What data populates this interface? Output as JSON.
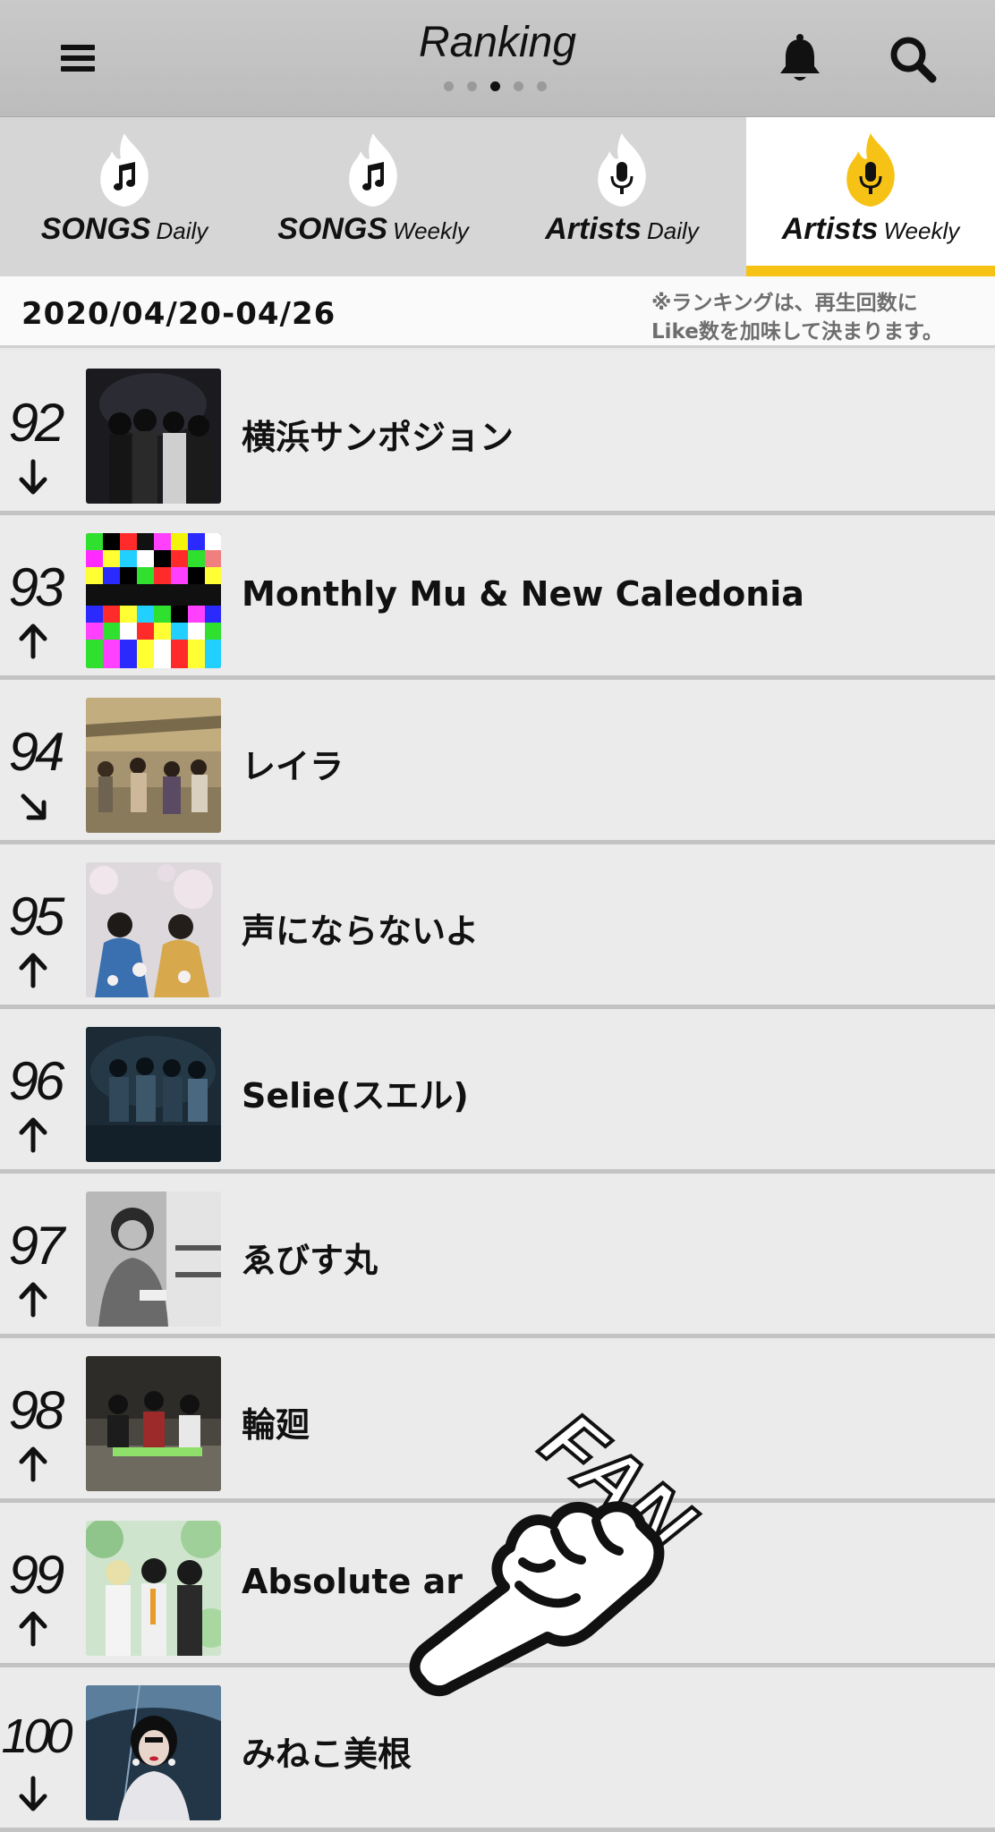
{
  "header": {
    "title": "Ranking",
    "menu_icon": "hamburger-menu-icon",
    "bell_icon": "bell-icon",
    "search_icon": "search-icon",
    "page_count": 5,
    "active_page": 3
  },
  "tabs": [
    {
      "main": "SONGS",
      "sub": "Daily",
      "icon": "music-note-icon",
      "active": false
    },
    {
      "main": "SONGS",
      "sub": "Weekly",
      "icon": "music-note-icon",
      "active": false
    },
    {
      "main": "Artists",
      "sub": "Daily",
      "icon": "microphone-icon",
      "active": false
    },
    {
      "main": "Artists",
      "sub": "Weekly",
      "icon": "microphone-icon",
      "active": true
    }
  ],
  "date_bar": {
    "date": "2020/04/20-04/26",
    "note_line1": "※ランキングは、再生回数に",
    "note_line2": "Like数を加味して決まります。"
  },
  "rankings": [
    {
      "rank": "92",
      "trend": "down",
      "name": "横浜サンポジョン"
    },
    {
      "rank": "93",
      "trend": "up",
      "name": "Monthly Mu & New Caledonia"
    },
    {
      "rank": "94",
      "trend": "down-right",
      "name": "レイラ"
    },
    {
      "rank": "95",
      "trend": "up",
      "name": "声にならないよ"
    },
    {
      "rank": "96",
      "trend": "up",
      "name": "Selie(スエル)"
    },
    {
      "rank": "97",
      "trend": "up",
      "name": "ゑびす丸"
    },
    {
      "rank": "98",
      "trend": "up",
      "name": "輪廻"
    },
    {
      "rank": "99",
      "trend": "up",
      "name": "Absolute ar"
    },
    {
      "rank": "100",
      "trend": "down",
      "name": "みねこ美根"
    }
  ],
  "fan_badge": {
    "text": "FAN",
    "icon": "pointing-hand-icon"
  },
  "colors": {
    "accent": "#f6c215",
    "header_bg": "#c4c4c4",
    "tab_bg": "#d6d6d6"
  }
}
